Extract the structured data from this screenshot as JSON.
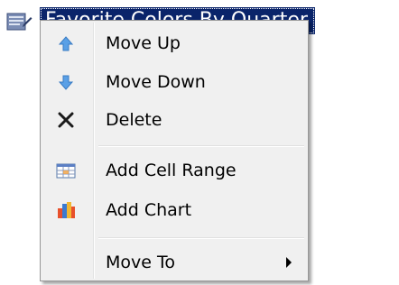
{
  "tree_node": {
    "label": "Favorite Colors By Quarter",
    "icon": "report-icon"
  },
  "context_menu": {
    "items": [
      {
        "label": "Move Up",
        "icon": "arrow-up-icon"
      },
      {
        "label": "Move Down",
        "icon": "arrow-down-icon"
      },
      {
        "label": "Delete",
        "icon": "delete-x-icon"
      },
      {
        "label": "Add Cell Range",
        "icon": "cell-range-icon"
      },
      {
        "label": "Add Chart",
        "icon": "bar-chart-icon"
      },
      {
        "label": "Move To",
        "icon": "",
        "has_submenu": true
      }
    ]
  },
  "colors": {
    "selection": "#0a246a",
    "menu_background": "#f0f0f0",
    "arrow_blue": "#4a90d9"
  }
}
